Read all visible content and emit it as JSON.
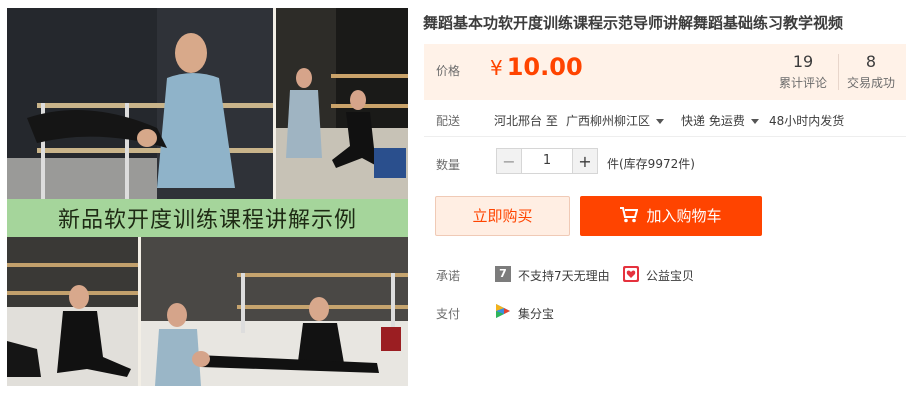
{
  "gallery": {
    "banner_text": "新品软开度训练课程讲解示例"
  },
  "product": {
    "title": "舞蹈基本功软开度训练课程示范导师讲解舞蹈基础练习教学视频"
  },
  "price": {
    "label": "价格",
    "currency": "¥",
    "value": "10.00",
    "color": "#ff4400"
  },
  "stats": {
    "reviews_count": "19",
    "reviews_label": "累计评论",
    "sales_count": "8",
    "sales_label": "交易成功"
  },
  "delivery": {
    "label": "配送",
    "from": "河北邢台 至",
    "to": "广西柳州柳江区",
    "shipping": "快递 免运费",
    "dispatch": "48小时内发货"
  },
  "quantity": {
    "label": "数量",
    "minus": "−",
    "value": "1",
    "plus": "+",
    "stock": "件(库存9972件)"
  },
  "actions": {
    "buy_now": "立即购买",
    "add_to_cart": "加入购物车"
  },
  "promise": {
    "label": "承诺",
    "no_return_icon_text": "7",
    "no_return": "不支持7天无理由",
    "charity": "公益宝贝"
  },
  "payment": {
    "label": "支付",
    "method": "集分宝"
  }
}
